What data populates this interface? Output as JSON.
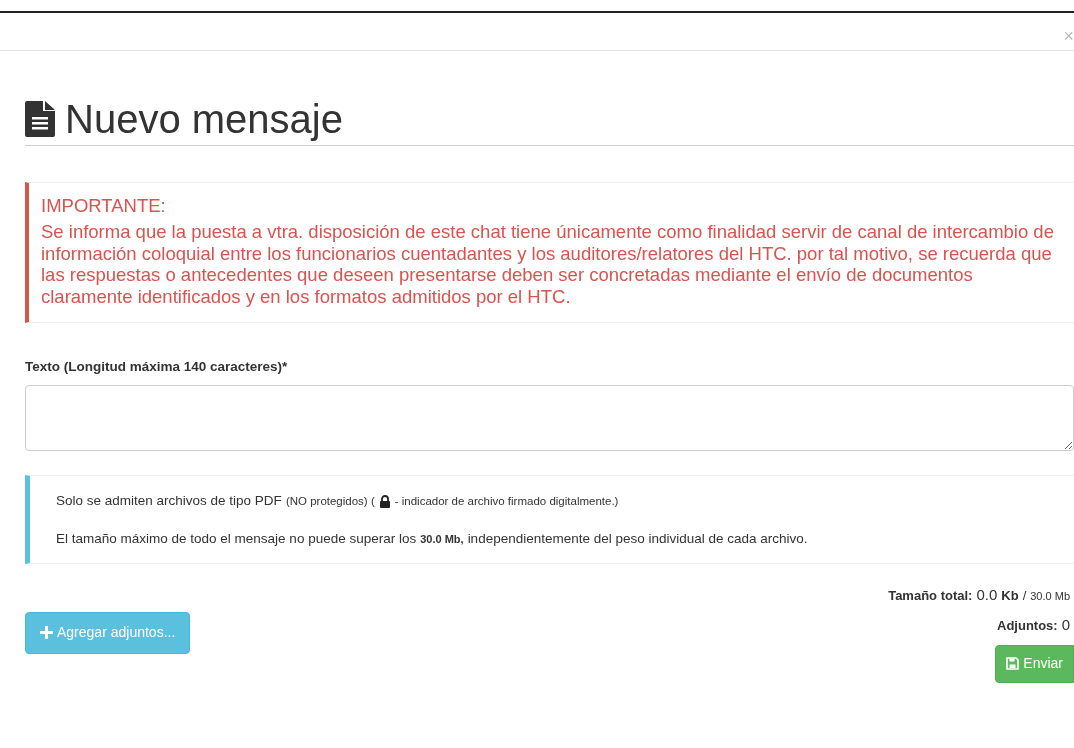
{
  "dialog": {
    "close": "×",
    "title": "Nuevo mensaje"
  },
  "notice": {
    "heading": "IMPORTANTE:",
    "body": "Se informa que la puesta a vtra. disposición de este chat tiene únicamente como finalidad servir de canal de intercambio de información coloquial entre los funcionarios cuentadantes y los auditores/relatores del HTC. por tal motivo, se recuerda que las respuestas o antecedentes que deseen presentarse deben ser concretadas mediante el envío de documentos claramente identificados y en los formatos admitidos por el HTC."
  },
  "text_field": {
    "label": "Texto (Longitud máxima 140 caracteres)*"
  },
  "info_lines": [
    {
      "parts": [
        {
          "kind": "normal",
          "text": "Solo se admiten archivos de tipo PDF"
        },
        {
          "kind": "small",
          "text": "(NO protegidos) ("
        },
        {
          "kind": "lock"
        },
        {
          "kind": "small",
          "text": "- indicador de archivo firmado digitalmente.)"
        }
      ]
    },
    {
      "parts": [
        {
          "kind": "normal",
          "text": "El tamaño máximo de todo el mensaje no puede superar los"
        },
        {
          "kind": "size",
          "text": "30.0 Mb,"
        },
        {
          "kind": "normal",
          "text": "independientemente del peso individual de cada archivo."
        }
      ]
    }
  ],
  "totals": [
    {
      "parts": [
        {
          "kind": "label",
          "text": "Tamaño total:"
        },
        {
          "kind": "value",
          "text": "0.0"
        },
        {
          "kind": "label",
          "text": "Kb"
        },
        {
          "kind": "plain",
          "text": "/"
        },
        {
          "kind": "small",
          "text": "30.0 Mb"
        }
      ]
    },
    {
      "parts": [
        {
          "kind": "label",
          "text": "Adjuntos:"
        },
        {
          "kind": "value",
          "text": "0"
        }
      ]
    }
  ],
  "buttons": {
    "add": "Agregar adjuntos...",
    "send": "Enviar"
  }
}
